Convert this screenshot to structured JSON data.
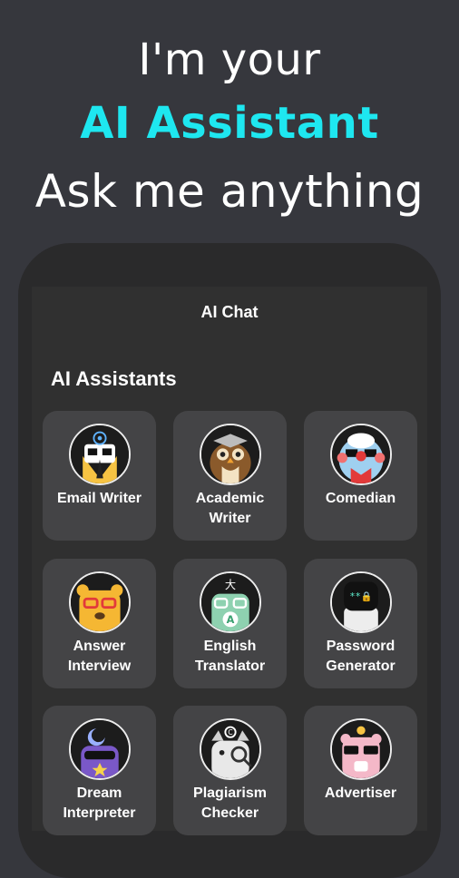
{
  "hero": {
    "line1": "I'm your",
    "line2": "AI Assistant",
    "line3": "Ask me anything"
  },
  "app": {
    "title": "AI Chat",
    "section_title": "AI Assistants"
  },
  "assistants": [
    {
      "label": "Email Writer",
      "icon": "email-writer-icon"
    },
    {
      "label": "Academic\nWriter",
      "icon": "academic-writer-icon"
    },
    {
      "label": "Comedian",
      "icon": "comedian-icon"
    },
    {
      "label": "Answer\nInterview",
      "icon": "answer-interview-icon"
    },
    {
      "label": "English\nTranslator",
      "icon": "english-translator-icon"
    },
    {
      "label": "Password\nGenerator",
      "icon": "password-generator-icon"
    },
    {
      "label": "Dream\nInterpreter",
      "icon": "dream-interpreter-icon"
    },
    {
      "label": "Plagiarism\nChecker",
      "icon": "plagiarism-checker-icon"
    },
    {
      "label": "Advertiser",
      "icon": "advertiser-icon"
    }
  ],
  "colors": {
    "background": "#36373d",
    "accent": "#1ee7f0",
    "card": "#444446"
  }
}
